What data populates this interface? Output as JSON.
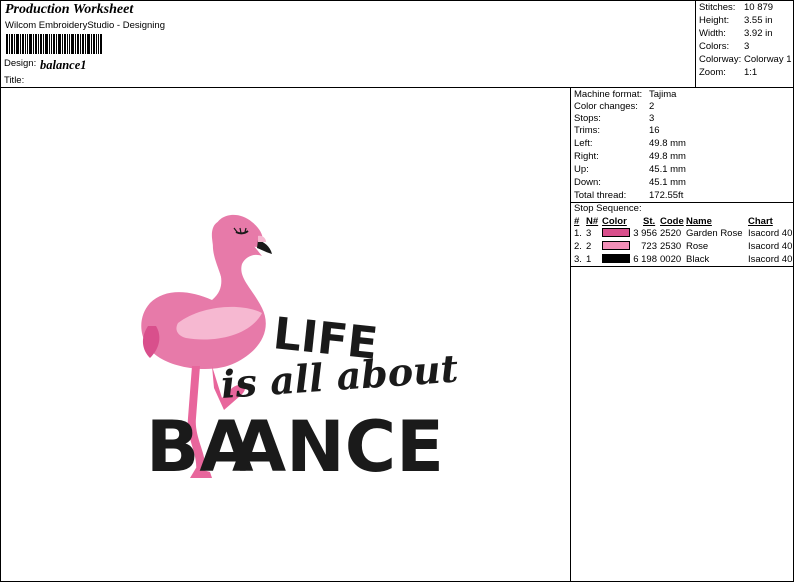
{
  "header": {
    "title": "Production Worksheet",
    "software": "Wilcom EmbroideryStudio - Designing",
    "design_label": "Design:",
    "design_value": "balance1",
    "title_label": "Title:"
  },
  "summary": [
    {
      "k": "Stitches:",
      "v": "10 879"
    },
    {
      "k": "Height:",
      "v": "3.55 in"
    },
    {
      "k": "Width:",
      "v": "3.92 in"
    },
    {
      "k": "Colors:",
      "v": "3"
    },
    {
      "k": "Colorway:",
      "v": "Colorway 1"
    },
    {
      "k": "Zoom:",
      "v": "1:1"
    }
  ],
  "machine": [
    {
      "k": "Machine format:",
      "v": "Tajima"
    },
    {
      "k": "Color changes:",
      "v": "2"
    },
    {
      "k": "Stops:",
      "v": "3"
    },
    {
      "k": "Trims:",
      "v": "16"
    },
    {
      "k": "Left:",
      "v": "49.8 mm"
    },
    {
      "k": "Right:",
      "v": "49.8 mm"
    },
    {
      "k": "Up:",
      "v": "45.1 mm"
    },
    {
      "k": "Down:",
      "v": "45.1 mm"
    },
    {
      "k": "Total thread:",
      "v": "172.55ft"
    }
  ],
  "stop_sequence": {
    "title": "Stop Sequence:",
    "headers": {
      "idx": "#",
      "n": "N#",
      "color": "Color",
      "st": "St.",
      "code": "Code",
      "name": "Name",
      "chart": "Chart"
    },
    "rows": [
      {
        "idx": "1.",
        "n": "3",
        "color": "#d94f8c",
        "st": "3 956",
        "code": "2520",
        "name": "Garden Rose",
        "chart": "Isacord 40"
      },
      {
        "idx": "2.",
        "n": "2",
        "color": "#f28fb8",
        "st": "723",
        "code": "2530",
        "name": "Rose",
        "chart": "Isacord 40"
      },
      {
        "idx": "3.",
        "n": "1",
        "color": "#000000",
        "st": "6 198",
        "code": "0020",
        "name": "Black",
        "chart": "Isacord 40"
      }
    ]
  },
  "artwork": {
    "line1": "LIFE",
    "line2": "is all about",
    "line3a": "BA",
    "line3b": "ANCE",
    "colors": {
      "body": "#e77aa9",
      "wing": "#f6b8d1",
      "dark_pink": "#d94f8c",
      "legs": "#e8669c",
      "black": "#1a1a1a"
    }
  }
}
